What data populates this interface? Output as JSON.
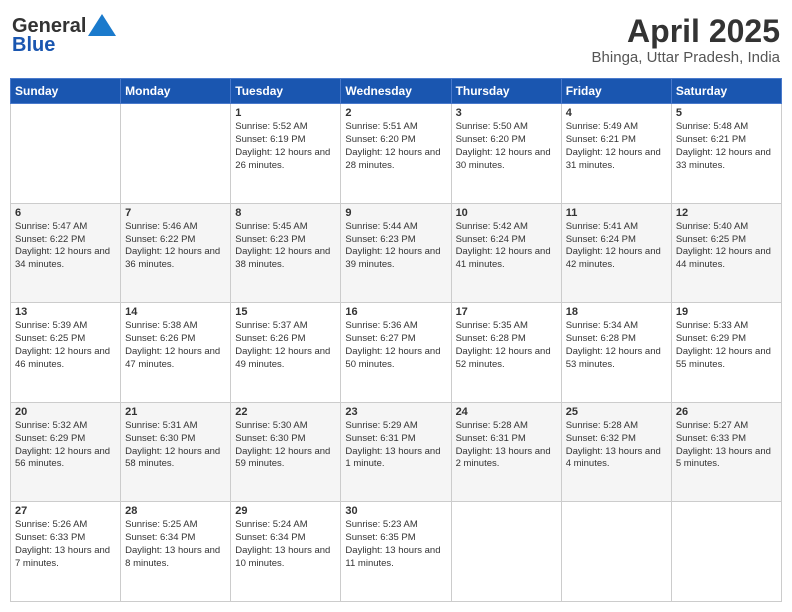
{
  "logo": {
    "general": "General",
    "blue": "Blue"
  },
  "header": {
    "month": "April 2025",
    "location": "Bhinga, Uttar Pradesh, India"
  },
  "days": [
    "Sunday",
    "Monday",
    "Tuesday",
    "Wednesday",
    "Thursday",
    "Friday",
    "Saturday"
  ],
  "weeks": [
    [
      {
        "day": "",
        "content": ""
      },
      {
        "day": "",
        "content": ""
      },
      {
        "day": "1",
        "content": "Sunrise: 5:52 AM\nSunset: 6:19 PM\nDaylight: 12 hours and 26 minutes."
      },
      {
        "day": "2",
        "content": "Sunrise: 5:51 AM\nSunset: 6:20 PM\nDaylight: 12 hours and 28 minutes."
      },
      {
        "day": "3",
        "content": "Sunrise: 5:50 AM\nSunset: 6:20 PM\nDaylight: 12 hours and 30 minutes."
      },
      {
        "day": "4",
        "content": "Sunrise: 5:49 AM\nSunset: 6:21 PM\nDaylight: 12 hours and 31 minutes."
      },
      {
        "day": "5",
        "content": "Sunrise: 5:48 AM\nSunset: 6:21 PM\nDaylight: 12 hours and 33 minutes."
      }
    ],
    [
      {
        "day": "6",
        "content": "Sunrise: 5:47 AM\nSunset: 6:22 PM\nDaylight: 12 hours and 34 minutes."
      },
      {
        "day": "7",
        "content": "Sunrise: 5:46 AM\nSunset: 6:22 PM\nDaylight: 12 hours and 36 minutes."
      },
      {
        "day": "8",
        "content": "Sunrise: 5:45 AM\nSunset: 6:23 PM\nDaylight: 12 hours and 38 minutes."
      },
      {
        "day": "9",
        "content": "Sunrise: 5:44 AM\nSunset: 6:23 PM\nDaylight: 12 hours and 39 minutes."
      },
      {
        "day": "10",
        "content": "Sunrise: 5:42 AM\nSunset: 6:24 PM\nDaylight: 12 hours and 41 minutes."
      },
      {
        "day": "11",
        "content": "Sunrise: 5:41 AM\nSunset: 6:24 PM\nDaylight: 12 hours and 42 minutes."
      },
      {
        "day": "12",
        "content": "Sunrise: 5:40 AM\nSunset: 6:25 PM\nDaylight: 12 hours and 44 minutes."
      }
    ],
    [
      {
        "day": "13",
        "content": "Sunrise: 5:39 AM\nSunset: 6:25 PM\nDaylight: 12 hours and 46 minutes."
      },
      {
        "day": "14",
        "content": "Sunrise: 5:38 AM\nSunset: 6:26 PM\nDaylight: 12 hours and 47 minutes."
      },
      {
        "day": "15",
        "content": "Sunrise: 5:37 AM\nSunset: 6:26 PM\nDaylight: 12 hours and 49 minutes."
      },
      {
        "day": "16",
        "content": "Sunrise: 5:36 AM\nSunset: 6:27 PM\nDaylight: 12 hours and 50 minutes."
      },
      {
        "day": "17",
        "content": "Sunrise: 5:35 AM\nSunset: 6:28 PM\nDaylight: 12 hours and 52 minutes."
      },
      {
        "day": "18",
        "content": "Sunrise: 5:34 AM\nSunset: 6:28 PM\nDaylight: 12 hours and 53 minutes."
      },
      {
        "day": "19",
        "content": "Sunrise: 5:33 AM\nSunset: 6:29 PM\nDaylight: 12 hours and 55 minutes."
      }
    ],
    [
      {
        "day": "20",
        "content": "Sunrise: 5:32 AM\nSunset: 6:29 PM\nDaylight: 12 hours and 56 minutes."
      },
      {
        "day": "21",
        "content": "Sunrise: 5:31 AM\nSunset: 6:30 PM\nDaylight: 12 hours and 58 minutes."
      },
      {
        "day": "22",
        "content": "Sunrise: 5:30 AM\nSunset: 6:30 PM\nDaylight: 12 hours and 59 minutes."
      },
      {
        "day": "23",
        "content": "Sunrise: 5:29 AM\nSunset: 6:31 PM\nDaylight: 13 hours and 1 minute."
      },
      {
        "day": "24",
        "content": "Sunrise: 5:28 AM\nSunset: 6:31 PM\nDaylight: 13 hours and 2 minutes."
      },
      {
        "day": "25",
        "content": "Sunrise: 5:28 AM\nSunset: 6:32 PM\nDaylight: 13 hours and 4 minutes."
      },
      {
        "day": "26",
        "content": "Sunrise: 5:27 AM\nSunset: 6:33 PM\nDaylight: 13 hours and 5 minutes."
      }
    ],
    [
      {
        "day": "27",
        "content": "Sunrise: 5:26 AM\nSunset: 6:33 PM\nDaylight: 13 hours and 7 minutes."
      },
      {
        "day": "28",
        "content": "Sunrise: 5:25 AM\nSunset: 6:34 PM\nDaylight: 13 hours and 8 minutes."
      },
      {
        "day": "29",
        "content": "Sunrise: 5:24 AM\nSunset: 6:34 PM\nDaylight: 13 hours and 10 minutes."
      },
      {
        "day": "30",
        "content": "Sunrise: 5:23 AM\nSunset: 6:35 PM\nDaylight: 13 hours and 11 minutes."
      },
      {
        "day": "",
        "content": ""
      },
      {
        "day": "",
        "content": ""
      },
      {
        "day": "",
        "content": ""
      }
    ]
  ]
}
